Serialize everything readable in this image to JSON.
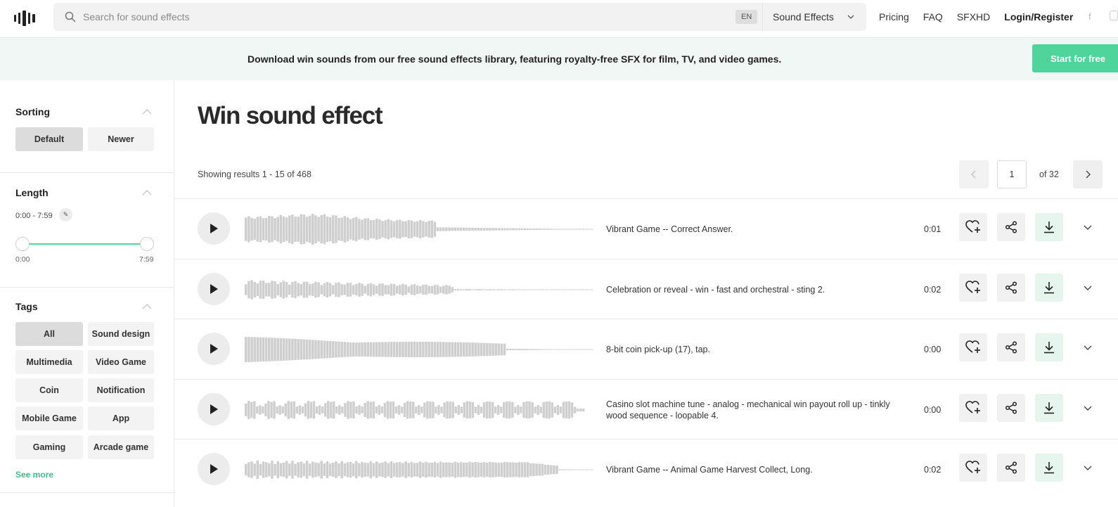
{
  "header": {
    "search_placeholder": "Search for sound effects",
    "lang": "EN",
    "category": "Sound Effects",
    "nav": [
      "Pricing",
      "FAQ",
      "SFXHD"
    ],
    "login": "Login/Register",
    "social_facebook": "f"
  },
  "banner": {
    "text": "Download win sounds from our free sound effects library, featuring royalty-free SFX for film, TV, and video games.",
    "cta": "Start for free"
  },
  "sidebar": {
    "sorting": {
      "title": "Sorting",
      "options": [
        "Default",
        "Newer"
      ],
      "active": "Default"
    },
    "length": {
      "title": "Length",
      "range": "0:00 - 7:59",
      "min_label": "0:00",
      "max_label": "7:59",
      "min_fraction": 0,
      "max_fraction": 1
    },
    "tags": {
      "title": "Tags",
      "items": [
        "All",
        "Sound design",
        "Multimedia",
        "Video Game",
        "Coin",
        "Notification",
        "Mobile Game",
        "App",
        "Gaming",
        "Arcade game"
      ],
      "active": "All",
      "see_more": "See more"
    }
  },
  "main": {
    "title": "Win sound effect",
    "results": "Showing results 1 - 15 of 468",
    "page": "1",
    "of_pages": "of 32"
  },
  "sounds": [
    {
      "title": "Vibrant Game -- Correct Answer.",
      "duration": "0:01"
    },
    {
      "title": "Celebration or reveal - win - fast and orchestral - sting 2.",
      "duration": "0:02"
    },
    {
      "title": "8-bit coin pick-up (17), tap.",
      "duration": "0:00"
    },
    {
      "title": "Casino slot machine tune - analog - mechanical win payout roll up - tinkly wood sequence - loopable 4.",
      "duration": "0:00"
    },
    {
      "title": "Vibrant Game -- Animal Game Harvest Collect, Long.",
      "duration": "0:02"
    }
  ],
  "colors": {
    "accent": "#4fd49c",
    "banner_bg": "#f1f7f5",
    "download_bg": "#e6f6ef",
    "waveform": "#cfcfcf"
  }
}
